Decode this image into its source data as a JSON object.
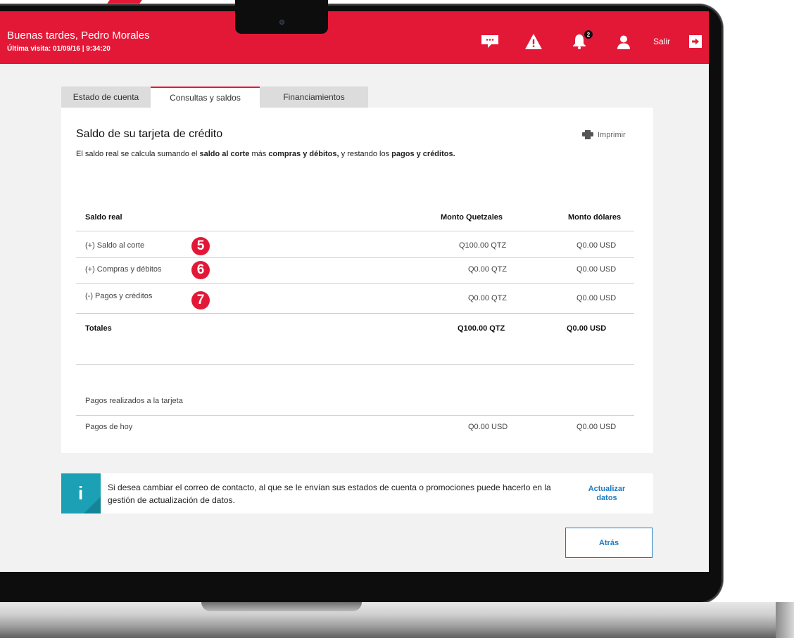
{
  "header": {
    "greeting": "Buenas tardes, Pedro Morales",
    "last_visit": "Última visita: 01/09/16  |  9:34:20",
    "notifications_count": "2",
    "logout_label": "Salir"
  },
  "tabs": [
    {
      "label": "Estado de cuenta"
    },
    {
      "label": "Consultas y saldos"
    },
    {
      "label": "Financiamientos"
    }
  ],
  "card": {
    "title": "Saldo de su tarjeta de crédito",
    "print_label": "Imprimir",
    "subtitle": {
      "part1": "El saldo real se calcula sumando el ",
      "bold1": "saldo al corte",
      "part2": " más ",
      "bold2": "compras y débitos,",
      "part3": " y restando los ",
      "bold3": "pagos y créditos."
    }
  },
  "balance_table": {
    "headers": [
      "Saldo real",
      "Monto Quetzales",
      "Monto dólares"
    ],
    "rows": [
      {
        "label": "(+) Saldo al corte",
        "qtz": "Q100.00 QTZ",
        "usd": "Q0.00 USD",
        "marker": "5"
      },
      {
        "label": "(+) Compras y débitos",
        "qtz": "Q0.00 QTZ",
        "usd": "Q0.00 USD",
        "marker": "6"
      },
      {
        "label": "(-) Pagos y créditos",
        "qtz": "Q0.00 QTZ",
        "usd": "Q0.00 USD",
        "marker": "7"
      }
    ],
    "totals": {
      "label": "Totales",
      "qtz": "Q100.00 QTZ",
      "usd": "Q0.00 USD"
    }
  },
  "payments": {
    "section_label": "Pagos realizados a la tarjeta",
    "rows": [
      {
        "label": "Pagos de hoy",
        "qtz": "Q0.00 USD",
        "usd": "Q0.00 USD"
      }
    ]
  },
  "info_banner": {
    "text": "Si desea cambiar el correo de contacto, al que se le envían sus estados de cuenta o promociones puede hacerlo en la gestión de actualización de datos.",
    "link_label": "Actualizar datos"
  },
  "back_label": "Atrás",
  "colors": {
    "brand_red": "#e31837",
    "info_teal": "#1ba0b5",
    "link_blue": "#1a7cc1"
  }
}
